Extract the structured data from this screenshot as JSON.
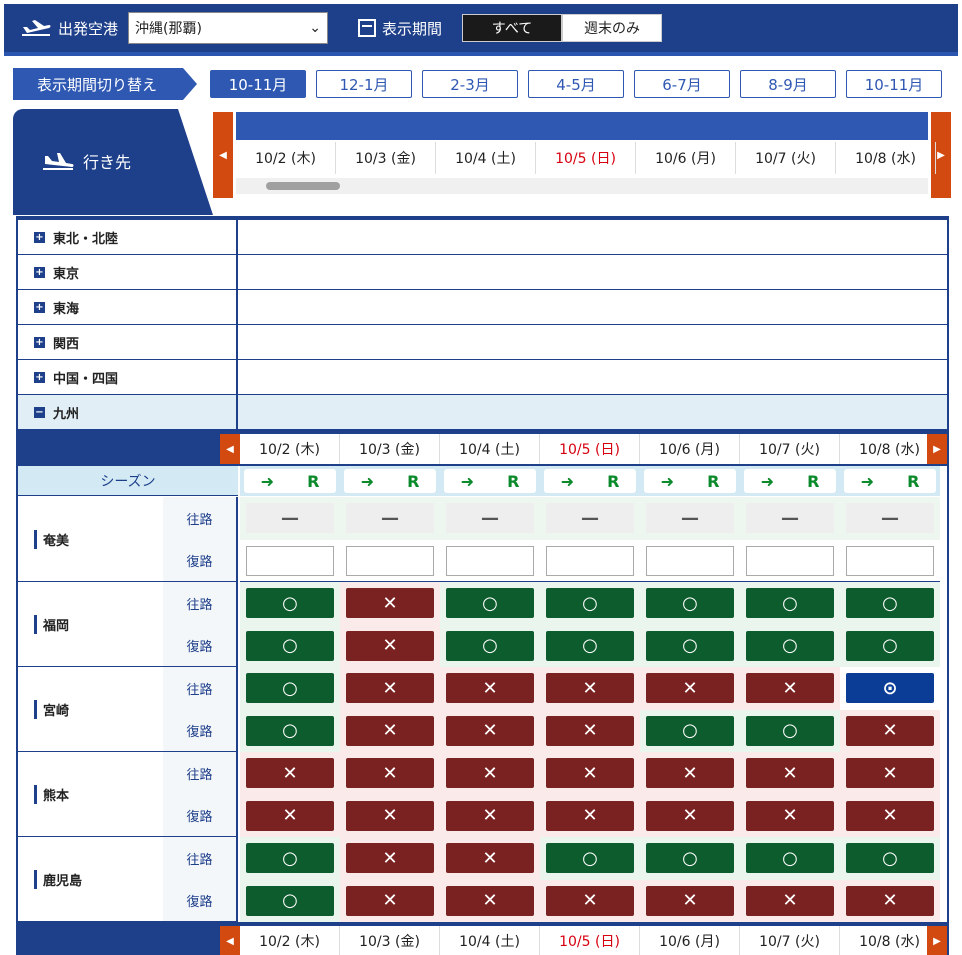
{
  "topbar": {
    "departure_label": "出発空港",
    "airport": "沖縄(那覇)",
    "period_label": "表示期間",
    "all_label": "すべて",
    "weekend_label": "週末のみ"
  },
  "months": {
    "label": "表示期間切り替え",
    "items": [
      "10-11月",
      "12-1月",
      "2-3月",
      "4-5月",
      "6-7月",
      "8-9月",
      "10-11月"
    ]
  },
  "dest_label": "行き先",
  "dates": [
    {
      "t": "10/2 (木)",
      "red": false
    },
    {
      "t": "10/3 (金)",
      "red": false
    },
    {
      "t": "10/4 (土)",
      "red": false
    },
    {
      "t": "10/5 (日)",
      "red": true
    },
    {
      "t": "10/6 (月)",
      "red": false
    },
    {
      "t": "10/7 (火)",
      "red": false
    },
    {
      "t": "10/8 (水)",
      "red": false
    }
  ],
  "regions": [
    "東北・北陸",
    "東京",
    "東海",
    "関西",
    "中国・四国",
    "九州"
  ],
  "season_label": "シーズン",
  "season_mark": {
    "arrow": "➜",
    "r": "R"
  },
  "dirs": {
    "out": "往路",
    "ret": "復路"
  },
  "marks": {
    "o": "○",
    "x": "✕",
    "d": "—",
    "p": "⊙"
  },
  "cities": [
    {
      "name": "奄美",
      "out": [
        "d",
        "d",
        "d",
        "d",
        "d",
        "d",
        "d"
      ],
      "ret": [
        "e",
        "e",
        "e",
        "e",
        "e",
        "e",
        "e"
      ]
    },
    {
      "name": "福岡",
      "out": [
        "o",
        "x",
        "o",
        "o",
        "o",
        "o",
        "o"
      ],
      "ret": [
        "o",
        "x",
        "o",
        "o",
        "o",
        "o",
        "o"
      ]
    },
    {
      "name": "宮崎",
      "out": [
        "o",
        "x",
        "x",
        "x",
        "x",
        "x",
        "p"
      ],
      "ret": [
        "o",
        "x",
        "x",
        "x",
        "o",
        "o",
        "x"
      ]
    },
    {
      "name": "熊本",
      "out": [
        "x",
        "x",
        "x",
        "x",
        "x",
        "x",
        "x"
      ],
      "ret": [
        "x",
        "x",
        "x",
        "x",
        "x",
        "x",
        "x"
      ]
    },
    {
      "name": "鹿児島",
      "out": [
        "o",
        "x",
        "x",
        "o",
        "o",
        "o",
        "o"
      ],
      "ret": [
        "o",
        "x",
        "x",
        "x",
        "x",
        "x",
        "x"
      ]
    }
  ]
}
